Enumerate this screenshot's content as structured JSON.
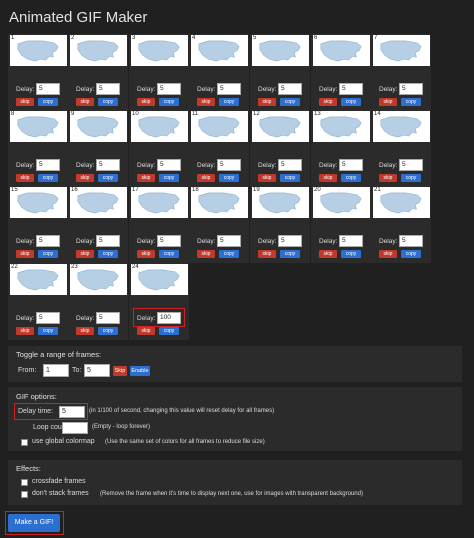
{
  "app": {
    "title": "Animated GIF Maker"
  },
  "frame_labels": {
    "delay": "Delay:",
    "skip": "skip",
    "copy": "copy"
  },
  "frames": [
    {
      "num": "1",
      "delay": "5"
    },
    {
      "num": "2",
      "delay": "5"
    },
    {
      "num": "3",
      "delay": "5"
    },
    {
      "num": "4",
      "delay": "5"
    },
    {
      "num": "5",
      "delay": "5"
    },
    {
      "num": "6",
      "delay": "5"
    },
    {
      "num": "7",
      "delay": "5"
    },
    {
      "num": "8",
      "delay": "5"
    },
    {
      "num": "9",
      "delay": "5"
    },
    {
      "num": "10",
      "delay": "5"
    },
    {
      "num": "11",
      "delay": "5"
    },
    {
      "num": "12",
      "delay": "5"
    },
    {
      "num": "13",
      "delay": "5"
    },
    {
      "num": "14",
      "delay": "5"
    },
    {
      "num": "15",
      "delay": "5"
    },
    {
      "num": "16",
      "delay": "5"
    },
    {
      "num": "17",
      "delay": "5"
    },
    {
      "num": "18",
      "delay": "5"
    },
    {
      "num": "19",
      "delay": "5"
    },
    {
      "num": "20",
      "delay": "5"
    },
    {
      "num": "21",
      "delay": "5"
    },
    {
      "num": "22",
      "delay": "5"
    },
    {
      "num": "23",
      "delay": "5"
    },
    {
      "num": "24",
      "delay": "100"
    }
  ],
  "range": {
    "title": "Toggle a range of frames:",
    "from_label": "From:",
    "from_value": "1",
    "to_label": "To:",
    "to_value": "5",
    "skip_label": "Skip",
    "enable_label": "Enable"
  },
  "gif_options": {
    "title": "GIF options:",
    "delay_label": "Delay time:",
    "delay_value": "5",
    "delay_note": "(in 1/100 of second, changing this value will reset delay for all frames)",
    "loop_label": "Loop count:",
    "loop_value": "",
    "loop_note": "(Empty - loop forever)",
    "colormap_label": "use global colormap",
    "colormap_note": "(Use the same set of colors for all frames to reduce file size)"
  },
  "effects": {
    "title": "Effects:",
    "crossfade_label": "crossfade frames",
    "nostack_label": "don't stack frames",
    "nostack_note": "(Remove the frame when it's time to display next one, use for images with transparent background)"
  },
  "make_button": "Make a GIF!"
}
